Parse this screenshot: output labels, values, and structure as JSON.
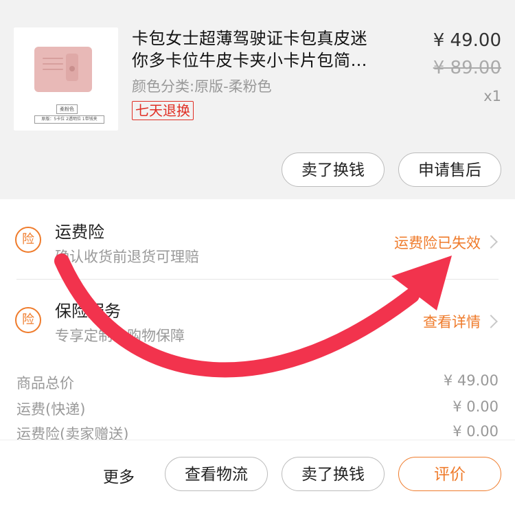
{
  "product": {
    "title_line1": "卡包女士超薄驾驶证卡包真皮迷",
    "title_line2": "你多卡位牛皮卡夹小卡片包简…",
    "variant": "颜色分类:原版-柔粉色",
    "return_badge": "七天退换",
    "price": "¥ 49.00",
    "original_price": "¥ 89.00",
    "quantity": "x1",
    "thumb_tag": "柔粉色",
    "thumb_note": "原版：5卡位 2透明位 1带钱夹"
  },
  "product_actions": {
    "sell_label": "卖了换钱",
    "after_sale_label": "申请售后"
  },
  "insurance": [
    {
      "icon": "险",
      "title": "运费险",
      "subtitle": "确认收货前退货可理赔",
      "status": "运费险已失效"
    },
    {
      "icon": "险",
      "title": "保险服务",
      "subtitle": "专享定制化购物保障",
      "status": "查看详情"
    }
  ],
  "summary": [
    {
      "label": "商品总价",
      "value": "¥ 49.00"
    },
    {
      "label": "运费(快递)",
      "value": "¥ 0.00"
    },
    {
      "label": "运费险(卖家赠送)",
      "value": "¥ 0.00"
    }
  ],
  "bottom_bar": {
    "more_label": "更多",
    "logistics_label": "查看物流",
    "sell_label": "卖了换钱",
    "review_label": "评价"
  },
  "colors": {
    "accent_orange": "#ef7b2b",
    "badge_red": "#e02e24",
    "arrow_red": "#f2334d"
  }
}
